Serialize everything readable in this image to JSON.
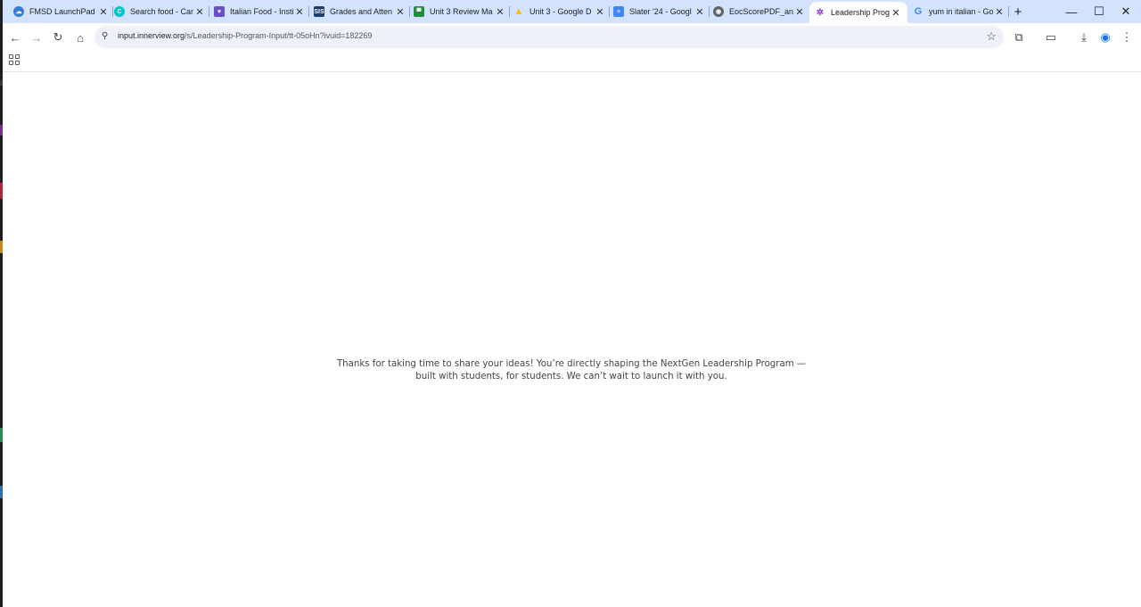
{
  "browser": {
    "tabs": [
      {
        "title": "FMSD LaunchPad",
        "favicon": "cloud-icon",
        "color": "#3a7bd5",
        "active": false
      },
      {
        "title": "Search food - Can",
        "favicon": "canva-icon",
        "color": "#00c4cc",
        "active": false
      },
      {
        "title": "Italian Food - Insti",
        "favicon": "chat-bubble-icon",
        "color": "#6b4fc8",
        "active": false
      },
      {
        "title": "Grades and Atten",
        "favicon": "sis-icon",
        "color": "#1a3e6e",
        "active": false
      },
      {
        "title": "Unit 3 Review Ma",
        "favicon": "classroom-icon",
        "color": "#1e8e3e",
        "active": false
      },
      {
        "title": "Unit 3 - Google D",
        "favicon": "drive-icon",
        "color": "#fbbc04",
        "active": false
      },
      {
        "title": "Slater '24 - Googl",
        "favicon": "docs-icon",
        "color": "#4285f4",
        "active": false
      },
      {
        "title": "EocScorePDF_anj",
        "favicon": "globe-icon",
        "color": "#5f6368",
        "active": false
      },
      {
        "title": "Leadership Progra",
        "favicon": "innerview-icon",
        "color": "#8e3bc9",
        "active": true
      },
      {
        "title": "yum in italian - Go",
        "favicon": "google-icon",
        "color": "#4285f4",
        "active": false
      }
    ],
    "address": {
      "host": "input.innerview.org",
      "path": "/s/Leadership-Program-Input/tt-05oHn?ivuid=182269"
    }
  },
  "page": {
    "message": "Thanks for taking  time to share your ideas! You’re directly shaping the NextGen Leadership Program — built with students, for students. We can’t wait to launch it with you."
  }
}
